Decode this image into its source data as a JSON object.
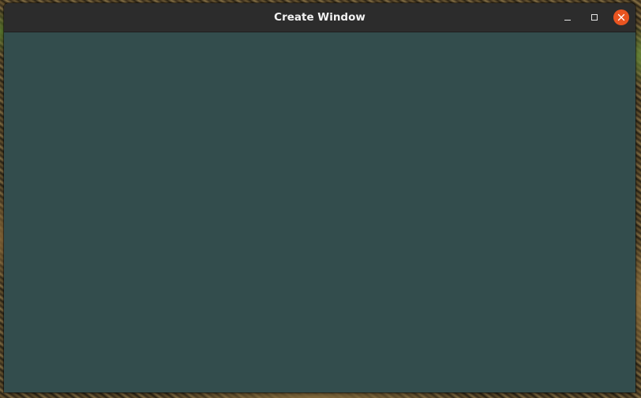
{
  "window": {
    "title": "Create Window",
    "background_color": "#334d4d",
    "titlebar_color": "#2c2c2c"
  },
  "controls": {
    "minimize_icon": "minimize-icon",
    "maximize_icon": "maximize-icon",
    "close_icon": "close-icon",
    "close_color": "#e95420"
  }
}
